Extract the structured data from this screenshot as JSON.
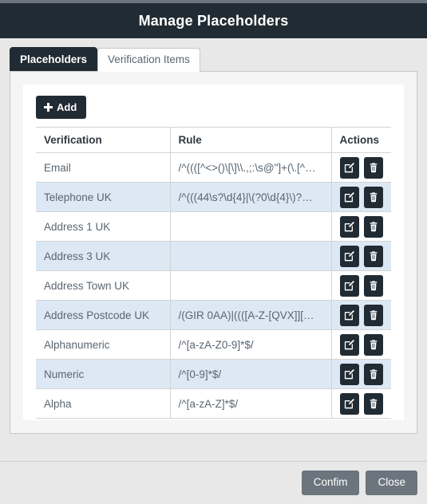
{
  "header": {
    "title": "Manage Placeholders"
  },
  "tabs": [
    {
      "label": "Placeholders",
      "state": "dark"
    },
    {
      "label": "Verification Items",
      "state": "active"
    }
  ],
  "toolbar": {
    "add_label": "Add",
    "add_icon": "plus-icon"
  },
  "table": {
    "columns": [
      "Verification",
      "Rule",
      "Actions"
    ],
    "action_icons": [
      "edit-icon",
      "trash-icon"
    ],
    "rows": [
      {
        "verification": "Email",
        "rule": "/^((([^<>()\\[\\]\\\\.,;:\\s@\"]+(\\.[^…"
      },
      {
        "verification": "Telephone UK",
        "rule": "/^(((44\\s?\\d{4}|\\(?0\\d{4}\\)?…"
      },
      {
        "verification": "Address 1 UK",
        "rule": ""
      },
      {
        "verification": "Address 3 UK",
        "rule": ""
      },
      {
        "verification": "Address Town UK",
        "rule": ""
      },
      {
        "verification": "Address Postcode UK",
        "rule": "/(GIR 0AA)|((([A-Z-[QVX]][…"
      },
      {
        "verification": "Alphanumeric",
        "rule": "/^[a-zA-Z0-9]*$/"
      },
      {
        "verification": "Numeric",
        "rule": "/^[0-9]*$/"
      },
      {
        "verification": "Alpha",
        "rule": "/^[a-zA-Z]*$/"
      }
    ]
  },
  "footer": {
    "confirm_label": "Confim",
    "close_label": "Close"
  },
  "colors": {
    "header_bg": "#212b33",
    "page_bg": "#e8e8e8",
    "panel_bg": "#f5f5f5",
    "card_bg": "#ffffff",
    "stripe": "#dce8f4",
    "footer_btn": "#6c757d",
    "text": "#5a6570"
  }
}
